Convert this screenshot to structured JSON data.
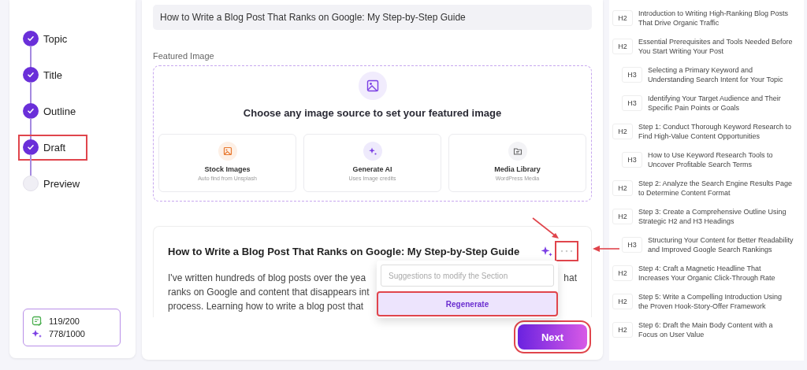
{
  "steps": [
    {
      "label": "Topic",
      "done": true,
      "highlighted": false
    },
    {
      "label": "Title",
      "done": true,
      "highlighted": false
    },
    {
      "label": "Outline",
      "done": true,
      "highlighted": false
    },
    {
      "label": "Draft",
      "done": true,
      "highlighted": true
    },
    {
      "label": "Preview",
      "done": false,
      "highlighted": false
    }
  ],
  "credits": [
    {
      "kind": "articles",
      "value": "119/200"
    },
    {
      "kind": "ai",
      "value": "778/1000"
    }
  ],
  "title_field": {
    "value": "How to Write a Blog Post That Ranks on Google: My Step-by-Step Guide"
  },
  "featured_image": {
    "label": "Featured Image",
    "prompt": "Choose any image source to set your featured image",
    "sources": [
      {
        "kind": "stock",
        "title": "Stock Images",
        "subtitle": "Auto find from Unsplash"
      },
      {
        "kind": "ai",
        "title": "Generate AI",
        "subtitle": "Uses Image credits"
      },
      {
        "kind": "library",
        "title": "Media Library",
        "subtitle": "WordPress Media"
      }
    ]
  },
  "section": {
    "heading": "How to Write a Blog Post That Ranks on Google: My Step-by-Step Guide",
    "sparkle_arrow": true,
    "more_highlighted": true,
    "more_arrow": true,
    "lines": [
      {
        "left": "I've written hundreds of blog posts over the yea",
        "right": "hat"
      },
      {
        "left": "ranks on Google and content that disappears int"
      },
      {
        "left": "process. Learning how to write a blog post that"
      }
    ],
    "popup": {
      "placeholder": "Suggestions to modify the Section",
      "button": "Regenerate",
      "highlighted": true
    }
  },
  "next_button": {
    "label": "Next",
    "highlighted": true
  },
  "outline": [
    {
      "tag": "H2",
      "text": "Introduction to Writing High-Ranking Blog Posts That Drive Organic Traffic"
    },
    {
      "tag": "H2",
      "text": "Essential Prerequisites and Tools Needed Before You Start Writing Your Post",
      "children": [
        {
          "tag": "H3",
          "text": "Selecting a Primary Keyword and Understanding Search Intent for Your Topic"
        },
        {
          "tag": "H3",
          "text": "Identifying Your Target Audience and Their Specific Pain Points or Goals"
        }
      ]
    },
    {
      "tag": "H2",
      "text": "Step 1: Conduct Thorough Keyword Research to Find High-Value Content Opportunities",
      "children": [
        {
          "tag": "H3",
          "text": "How to Use Keyword Research Tools to Uncover Profitable Search Terms"
        }
      ]
    },
    {
      "tag": "H2",
      "text": "Step 2: Analyze the Search Engine Results Page to Determine Content Format"
    },
    {
      "tag": "H2",
      "text": "Step 3: Create a Comprehensive Outline Using Strategic H2 and H3 Headings",
      "children": [
        {
          "tag": "H3",
          "text": "Structuring Your Content for Better Readability and Improved Google Search Rankings"
        }
      ]
    },
    {
      "tag": "H2",
      "text": "Step 4: Craft a Magnetic Headline That Increases Your Organic Click-Through Rate"
    },
    {
      "tag": "H2",
      "text": "Step 5: Write a Compelling Introduction Using the Proven Hook-Story-Offer Framework"
    },
    {
      "tag": "H2",
      "text": "Step 6: Draft the Main Body Content with a Focus on User Value"
    }
  ]
}
